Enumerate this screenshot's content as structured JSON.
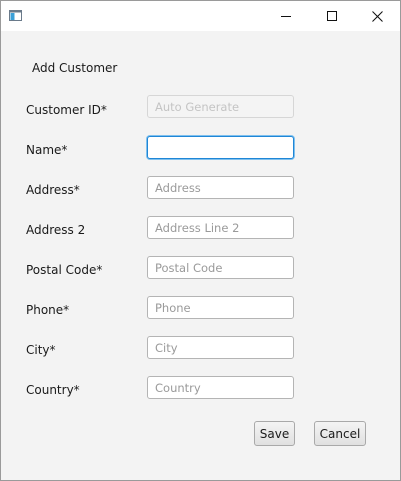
{
  "form": {
    "title": "Add Customer",
    "fields": [
      {
        "label": "Customer ID*",
        "placeholder": "Auto Generate",
        "value": ""
      },
      {
        "label": "Name*",
        "placeholder": "",
        "value": ""
      },
      {
        "label": "Address*",
        "placeholder": "Address",
        "value": ""
      },
      {
        "label": "Address 2",
        "placeholder": "Address Line 2",
        "value": ""
      },
      {
        "label": "Postal Code*",
        "placeholder": "Postal Code",
        "value": ""
      },
      {
        "label": "Phone*",
        "placeholder": "Phone",
        "value": ""
      },
      {
        "label": "City*",
        "placeholder": "City",
        "value": ""
      },
      {
        "label": "Country*",
        "placeholder": "Country",
        "value": ""
      }
    ]
  },
  "buttons": {
    "save": "Save",
    "cancel": "Cancel"
  },
  "icons": {
    "app": "window-icon",
    "minimize": "minimize-icon",
    "maximize": "maximize-icon",
    "close": "close-icon"
  },
  "colors": {
    "focus_border": "#1f86d6",
    "background": "#f3f3f3"
  }
}
